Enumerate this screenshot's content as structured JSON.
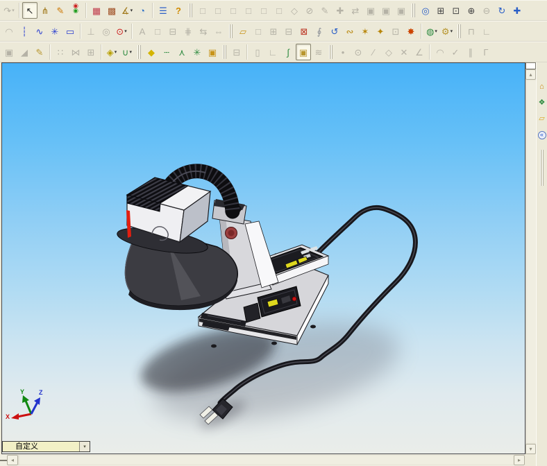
{
  "colors": {
    "toolbar_bg": "#ece9d8",
    "disabled_icon": "#b5b2a6",
    "viewport_sky_top": "#47b2f8",
    "viewport_ground": "#eaede9",
    "model_body": "#d6d6da",
    "model_shade": "#3c3c42",
    "accent_red": "#cc2222",
    "accent_yellow": "#ded81e",
    "triad_x": "#cc1111",
    "triad_y": "#118811",
    "triad_z": "#2233cc"
  },
  "glyphs": {
    "dropdown_small": "▾",
    "up": "▴",
    "down": "▾",
    "left": "◂",
    "right": "▸"
  },
  "config_selector": {
    "value": "自定义"
  },
  "viewport": {
    "triad": {
      "x": "X",
      "y": "Y",
      "z": "Z"
    }
  },
  "task_pane": {
    "icons": [
      {
        "n": "solidworks-resources",
        "g": "⌂",
        "c": "#c8820a"
      },
      {
        "n": "design-library",
        "g": "❖",
        "c": "#2e8b40"
      },
      {
        "n": "file-explorer",
        "g": "▱",
        "c": "#d9a520"
      },
      {
        "n": "collapse-pane",
        "g": "«",
        "c": "#2255cc",
        "round": true
      }
    ]
  },
  "toolbars": {
    "rows": [
      {
        "name": "standard",
        "items": [
          {
            "t": "b",
            "n": "redo",
            "g": "↷",
            "d": 1,
            "dd": 1
          },
          {
            "t": "s"
          },
          {
            "t": "b",
            "n": "select",
            "g": "↖",
            "c": "#222222",
            "a": 1
          },
          {
            "t": "b",
            "n": "selection-filter",
            "g": "⋔",
            "c": "#a07818"
          },
          {
            "t": "b",
            "n": "sketch",
            "g": "✎",
            "c": "#cc7700"
          },
          {
            "t": "b",
            "n": "display-states",
            "g": "◉",
            "c": "#1f9d1f",
            "fs": 9,
            "sh": "0 -7px 0 #cc2222"
          },
          {
            "t": "s"
          },
          {
            "t": "b",
            "n": "edit-color",
            "g": "▦",
            "c": "#c03a4a"
          },
          {
            "t": "b",
            "n": "apply-texture",
            "g": "▩",
            "c": "#a2542a"
          },
          {
            "t": "b",
            "n": "measure",
            "g": "∡",
            "c": "#a07818",
            "dd": 1
          },
          {
            "t": "b",
            "n": "curvature",
            "g": "◔",
            "c": "#2b6fc7"
          },
          {
            "t": "s"
          },
          {
            "t": "b",
            "n": "design-checker",
            "g": "☰",
            "c": "#2b5fc7"
          },
          {
            "t": "b",
            "n": "help",
            "g": "?",
            "c": "#d08a00",
            "bold": 1
          },
          {
            "t": "g"
          },
          {
            "t": "b",
            "n": "view-front",
            "g": "□",
            "d": 1
          },
          {
            "t": "b",
            "n": "view-back",
            "g": "□",
            "d": 1
          },
          {
            "t": "b",
            "n": "view-left",
            "g": "□",
            "d": 1
          },
          {
            "t": "b",
            "n": "view-right",
            "g": "□",
            "d": 1
          },
          {
            "t": "b",
            "n": "view-top",
            "g": "□",
            "d": 1
          },
          {
            "t": "b",
            "n": "view-bottom",
            "g": "□",
            "d": 1
          },
          {
            "t": "b",
            "n": "view-isometric",
            "g": "◇",
            "d": 1
          },
          {
            "t": "b",
            "n": "normal-to",
            "g": "⊘",
            "d": 1
          },
          {
            "t": "b",
            "n": "3d-drawing-view",
            "g": "✎",
            "d": 1
          },
          {
            "t": "b",
            "n": "reference-view",
            "g": "✚",
            "d": 1
          },
          {
            "t": "b",
            "n": "link-views",
            "g": "⇄",
            "d": 1
          },
          {
            "t": "b",
            "n": "wireframe",
            "g": "▣",
            "d": 1
          },
          {
            "t": "b",
            "n": "hidden-lines-visible",
            "g": "▣",
            "d": 1
          },
          {
            "t": "b",
            "n": "hidden-lines-removed",
            "g": "▣",
            "d": 1
          },
          {
            "t": "g"
          },
          {
            "t": "b",
            "n": "zoom-to-fit",
            "g": "◎",
            "c": "#2b5fc7"
          },
          {
            "t": "b",
            "n": "zoom-to-area",
            "g": "⊞",
            "c": "#444444"
          },
          {
            "t": "b",
            "n": "zoom-to-selection",
            "g": "⊡",
            "c": "#444444"
          },
          {
            "t": "b",
            "n": "zoom-in-out",
            "g": "⊕",
            "c": "#444444"
          },
          {
            "t": "b",
            "n": "zoom-out",
            "g": "⊖",
            "d": 1
          },
          {
            "t": "b",
            "n": "rotate-view",
            "g": "↻",
            "c": "#2b5fc7"
          },
          {
            "t": "b",
            "n": "pan",
            "g": "✚",
            "c": "#2b5fc7"
          }
        ]
      },
      {
        "name": "sketch-assembly",
        "items": [
          {
            "t": "b",
            "n": "fillet",
            "g": "◠",
            "d": 1
          },
          {
            "t": "b",
            "n": "centerline",
            "g": "┆",
            "c": "#2b3fd0"
          },
          {
            "t": "b",
            "n": "spline",
            "g": "∿",
            "c": "#2b3fd0"
          },
          {
            "t": "b",
            "n": "sketch-point",
            "g": "✳",
            "c": "#2b3fd0"
          },
          {
            "t": "b",
            "n": "selection-box",
            "g": "▭",
            "c": "#2b3fd0"
          },
          {
            "t": "s"
          },
          {
            "t": "b",
            "n": "perpendicular-relation",
            "g": "⊥",
            "d": 1
          },
          {
            "t": "b",
            "n": "concentric-relation",
            "g": "◎",
            "d": 1
          },
          {
            "t": "b",
            "n": "smart-dimension",
            "g": "⊙",
            "c": "#cc2222",
            "dd": 1
          },
          {
            "t": "s"
          },
          {
            "t": "b",
            "n": "balloon",
            "g": "A",
            "d": 1
          },
          {
            "t": "b",
            "n": "annotation-view",
            "g": "□",
            "d": 1
          },
          {
            "t": "b",
            "n": "surface-finish",
            "g": "⊟",
            "d": 1
          },
          {
            "t": "b",
            "n": "weld-symbol",
            "g": "⋕",
            "d": 1
          },
          {
            "t": "b",
            "n": "swap-views",
            "g": "⇆",
            "d": 1
          },
          {
            "t": "b",
            "n": "stretch",
            "g": "⇔",
            "d": 1
          },
          {
            "t": "g"
          },
          {
            "t": "b",
            "n": "insert-component",
            "g": "▱",
            "c": "#c8941a"
          },
          {
            "t": "b",
            "n": "new-part",
            "g": "□",
            "d": 1
          },
          {
            "t": "b",
            "n": "new-assembly",
            "g": "⊞",
            "d": 1
          },
          {
            "t": "b",
            "n": "make-block",
            "g": "⊟",
            "d": 1
          },
          {
            "t": "b",
            "n": "component-states",
            "g": "⊠",
            "c": "#bb3322"
          },
          {
            "t": "b",
            "n": "attachment",
            "g": "∮",
            "c": "#8a8e96"
          },
          {
            "t": "b",
            "n": "rotate-component",
            "g": "↺",
            "c": "#2b5fc7"
          },
          {
            "t": "b",
            "n": "move-component",
            "g": "∾",
            "c": "#b8860b"
          },
          {
            "t": "b",
            "n": "smart-fasteners",
            "g": "✶",
            "c": "#b8860b"
          },
          {
            "t": "b",
            "n": "assembly-features",
            "g": "✦",
            "c": "#b8860b"
          },
          {
            "t": "b",
            "n": "interference-detection",
            "g": "⊡",
            "d": 1
          },
          {
            "t": "b",
            "n": "collision-detection",
            "g": "✸",
            "c": "#cc4400"
          },
          {
            "t": "s"
          },
          {
            "t": "b",
            "n": "assembly-transparency",
            "g": "◍",
            "c": "#2e8b40",
            "dd": 1
          },
          {
            "t": "b",
            "n": "physical-simulation",
            "g": "⚙",
            "c": "#b8962e",
            "dd": 1
          },
          {
            "t": "g"
          },
          {
            "t": "b",
            "n": "suppress",
            "g": "⊓",
            "d": 1
          },
          {
            "t": "b",
            "n": "large-assembly-mode",
            "g": "∟",
            "d": 1
          }
        ]
      },
      {
        "name": "features-routing",
        "items": [
          {
            "t": "b",
            "n": "boss-extrude",
            "g": "▣",
            "d": 1
          },
          {
            "t": "b",
            "n": "chamfer",
            "g": "◢",
            "d": 1
          },
          {
            "t": "b",
            "n": "edit-component",
            "g": "✎",
            "c": "#b8962e"
          },
          {
            "t": "s"
          },
          {
            "t": "b",
            "n": "pattern",
            "g": "∷",
            "d": 1
          },
          {
            "t": "b",
            "n": "mirror-components",
            "g": "⋈",
            "d": 1
          },
          {
            "t": "b",
            "n": "move-copy",
            "g": "⊞",
            "d": 1
          },
          {
            "t": "s"
          },
          {
            "t": "b",
            "n": "mate",
            "g": "◈",
            "c": "#b8a000",
            "dd": 1
          },
          {
            "t": "b",
            "n": "route",
            "g": "∪",
            "c": "#2e8b40",
            "dd": 1
          },
          {
            "t": "g"
          },
          {
            "t": "b",
            "n": "smart-mate",
            "g": "◆",
            "c": "#d4b400"
          },
          {
            "t": "b",
            "n": "add-route-point",
            "g": "┄",
            "c": "#2e8b40"
          },
          {
            "t": "b",
            "n": "move-triad",
            "g": "⋏",
            "c": "#2e8b40"
          },
          {
            "t": "b",
            "n": "route-point",
            "g": "✳",
            "c": "#2e8b40"
          },
          {
            "t": "b",
            "n": "envelope",
            "g": "▣",
            "c": "#c8941a"
          },
          {
            "t": "g"
          },
          {
            "t": "b",
            "n": "reorder-route",
            "g": "⊟",
            "d": 1
          },
          {
            "t": "s"
          },
          {
            "t": "b",
            "n": "extrude-route",
            "g": "▯",
            "d": 1
          },
          {
            "t": "b",
            "n": "corner-sketch",
            "g": "∟",
            "d": 1
          },
          {
            "t": "b",
            "n": "route-spline",
            "g": "∫",
            "c": "#2e8b40"
          },
          {
            "t": "b",
            "n": "edit-route",
            "g": "▣",
            "c": "#b8962e",
            "a": 1
          },
          {
            "t": "b",
            "n": "pipe",
            "g": "≋",
            "d": 1
          },
          {
            "t": "g"
          },
          {
            "t": "b",
            "n": "sketch-point-tool",
            "g": "•",
            "d": 1
          },
          {
            "t": "b",
            "n": "sketch-circle",
            "g": "⊙",
            "d": 1
          },
          {
            "t": "b",
            "n": "sketch-line",
            "g": "∕",
            "d": 1
          },
          {
            "t": "b",
            "n": "sketch-polygon",
            "g": "◇",
            "d": 1
          },
          {
            "t": "b",
            "n": "trim-entities",
            "g": "✕",
            "d": 1
          },
          {
            "t": "b",
            "n": "sketch-angle",
            "g": "∠",
            "d": 1
          },
          {
            "t": "s"
          },
          {
            "t": "b",
            "n": "sketch-arc",
            "g": "◠",
            "d": 1
          },
          {
            "t": "b",
            "n": "tangent-arc",
            "g": "✓",
            "d": 1
          },
          {
            "t": "b",
            "n": "parallel-relation",
            "g": "∥",
            "d": 1
          },
          {
            "t": "b",
            "n": "corner-rectangle",
            "g": "Γ",
            "d": 1
          }
        ]
      }
    ]
  }
}
